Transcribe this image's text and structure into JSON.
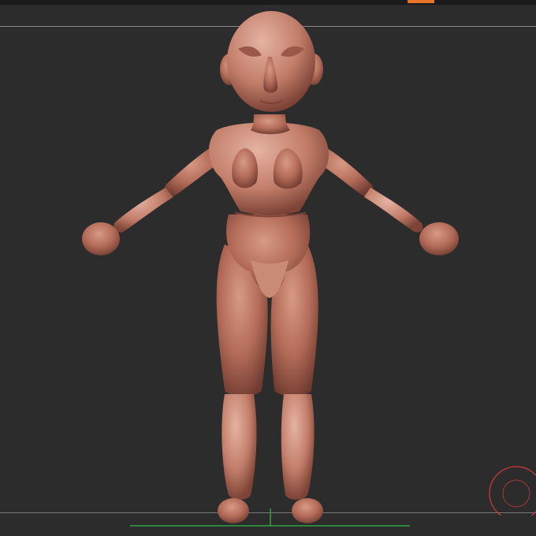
{
  "viewport": {
    "background": "#2c2c2c",
    "accent_color": "#e8742a",
    "model": {
      "subject": "clay-figure-mannequin",
      "color": "#b5705e"
    },
    "floor_grid": {
      "x_axis_color": "#2ea043",
      "y_axis_color": "#2ea043"
    },
    "navigation_gizmo": {
      "icon": "rotate-circle-icon",
      "color": "#d23a3a"
    }
  }
}
